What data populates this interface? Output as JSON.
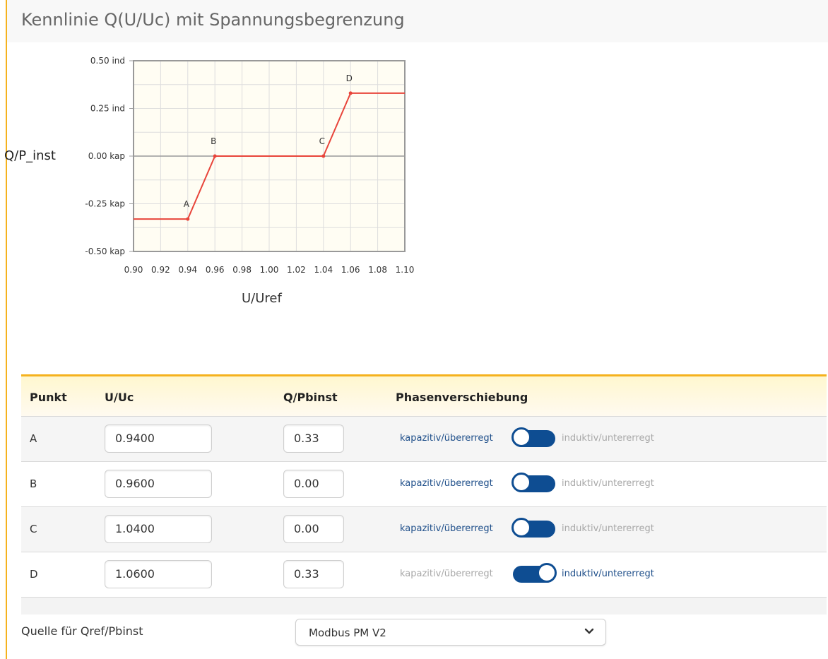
{
  "page": {
    "title": "Kennlinie Q(U/Uc) mit Spannungsbegrenzung"
  },
  "chart_data": {
    "type": "line",
    "xlabel": "U/Uref",
    "ylabel": "Q/P_inst",
    "xlim": [
      0.9,
      1.1
    ],
    "ylim": [
      -0.5,
      0.5
    ],
    "x_ticks": [
      "0.90",
      "0.92",
      "0.94",
      "0.96",
      "0.98",
      "1.00",
      "1.02",
      "1.04",
      "1.06",
      "1.08",
      "1.10"
    ],
    "y_ticks": [
      {
        "value": 0.5,
        "label": "0.50 ind"
      },
      {
        "value": 0.25,
        "label": "0.25 ind"
      },
      {
        "value": 0.0,
        "label": "0.00 kap"
      },
      {
        "value": -0.25,
        "label": "-0.25 kap"
      },
      {
        "value": -0.5,
        "label": "-0.50 kap"
      }
    ],
    "grid": true,
    "series": [
      {
        "color": "#e8443a",
        "points": [
          [
            0.9,
            -0.33
          ],
          [
            0.94,
            -0.33
          ],
          [
            0.96,
            0.0
          ],
          [
            1.04,
            0.0
          ],
          [
            1.06,
            0.33
          ],
          [
            1.1,
            0.33
          ]
        ]
      }
    ],
    "point_labels": [
      {
        "name": "A",
        "x": 0.94,
        "y": -0.33
      },
      {
        "name": "B",
        "x": 0.96,
        "y": 0.0
      },
      {
        "name": "C",
        "x": 1.04,
        "y": 0.0
      },
      {
        "name": "D",
        "x": 1.06,
        "y": 0.33
      }
    ],
    "colors": {
      "plot_bg": "#fffdf3",
      "grid": "#dddddd",
      "axis": "#999999"
    }
  },
  "table": {
    "headers": {
      "point": "Punkt",
      "u": "U/Uc",
      "q": "Q/Pbinst",
      "phase": "Phasenverschiebung"
    },
    "rows": [
      {
        "point": "A",
        "u": "0.9400",
        "q": "0.33",
        "kap": "kapazitiv/übererregt",
        "ind": "induktiv/untererregt",
        "inductive": false
      },
      {
        "point": "B",
        "u": "0.9600",
        "q": "0.00",
        "kap": "kapazitiv/übererregt",
        "ind": "induktiv/untererregt",
        "inductive": false
      },
      {
        "point": "C",
        "u": "1.0400",
        "q": "0.00",
        "kap": "kapazitiv/übererregt",
        "ind": "induktiv/untererregt",
        "inductive": false
      },
      {
        "point": "D",
        "u": "1.0600",
        "q": "0.33",
        "kap": "kapazitiv/übererregt",
        "ind": "induktiv/untererregt",
        "inductive": true
      }
    ]
  },
  "source": {
    "label": "Quelle für Qref/Pbinst",
    "value": "Modbus PM V2"
  },
  "colors": {
    "accent": "#f5b21e",
    "toggle": "#0e4d92",
    "active_text": "#1f4f8a",
    "inactive_text": "#a8a8a8"
  }
}
